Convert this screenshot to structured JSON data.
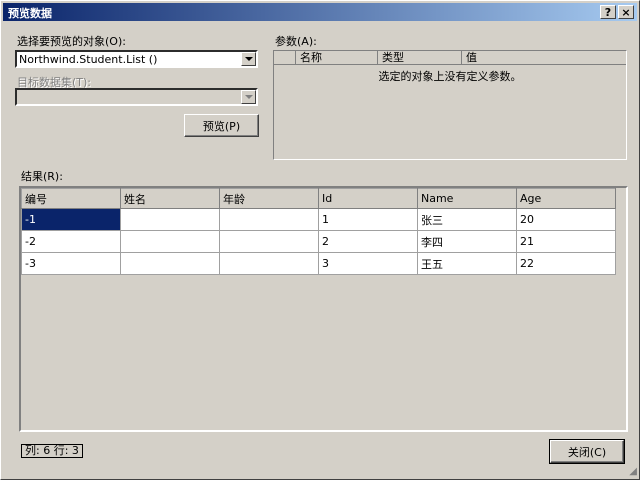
{
  "window": {
    "title": "预览数据",
    "help_label": "?",
    "close_label": "×"
  },
  "object": {
    "label": "选择要预览的对象(O):",
    "value": "Northwind.Student.List ()"
  },
  "target": {
    "label": "目标数据集(T):",
    "value": ""
  },
  "preview_button": "预览(P)",
  "params": {
    "label": "参数(A):",
    "headers": [
      "名称",
      "类型",
      "值"
    ],
    "empty_message": "选定的对象上没有定义参数。"
  },
  "results": {
    "label": "结果(R):",
    "columns": [
      "编号",
      "姓名",
      "年龄",
      "Id",
      "Name",
      "Age"
    ],
    "rows": [
      [
        "-1",
        "",
        "",
        "1",
        "张三",
        "20"
      ],
      [
        "-2",
        "",
        "",
        "2",
        "李四",
        "21"
      ],
      [
        "-3",
        "",
        "",
        "3",
        "王五",
        "22"
      ]
    ]
  },
  "status": {
    "text": "列: 6   行: 3"
  },
  "close_button": "关闭(C)"
}
